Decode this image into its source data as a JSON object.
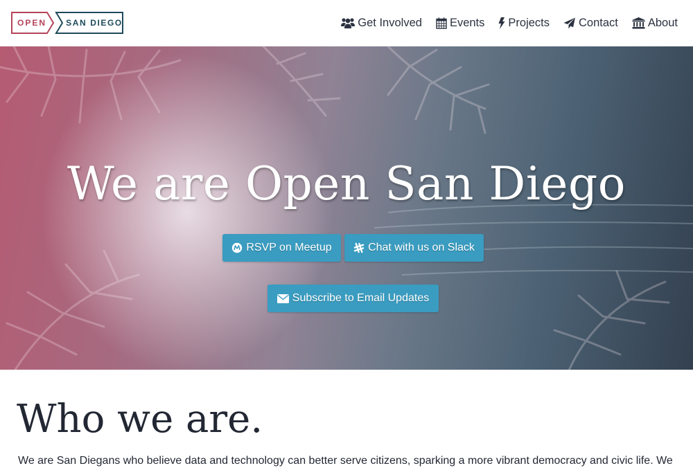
{
  "logo": {
    "left_text": "OPEN",
    "right_text": "SAN DIEGO",
    "colors": {
      "open": "#b5435a",
      "san_diego": "#1e4a5b"
    }
  },
  "nav": {
    "items": [
      {
        "label": "Get Involved",
        "icon": "users-icon"
      },
      {
        "label": "Events",
        "icon": "calendar-icon"
      },
      {
        "label": "Projects",
        "icon": "bolt-icon"
      },
      {
        "label": "Contact",
        "icon": "paper-plane-icon"
      },
      {
        "label": "About",
        "icon": "institution-icon"
      }
    ]
  },
  "hero": {
    "title": "We are Open San Diego",
    "buttons": {
      "meetup": {
        "label": "RSVP on Meetup",
        "icon": "meetup-icon"
      },
      "slack": {
        "label": "Chat with us on Slack",
        "icon": "slack-icon"
      },
      "email": {
        "label": "Subscribe to Email Updates",
        "icon": "envelope-icon"
      }
    },
    "colors": {
      "button": "#3a9cc0",
      "pink": "#b55b72",
      "ocean": "#33404f"
    }
  },
  "about": {
    "heading": "Who we are.",
    "text": "We are San Diegans who believe data and technology can better serve citizens, sparking a more vibrant democracy and civic life. We"
  }
}
